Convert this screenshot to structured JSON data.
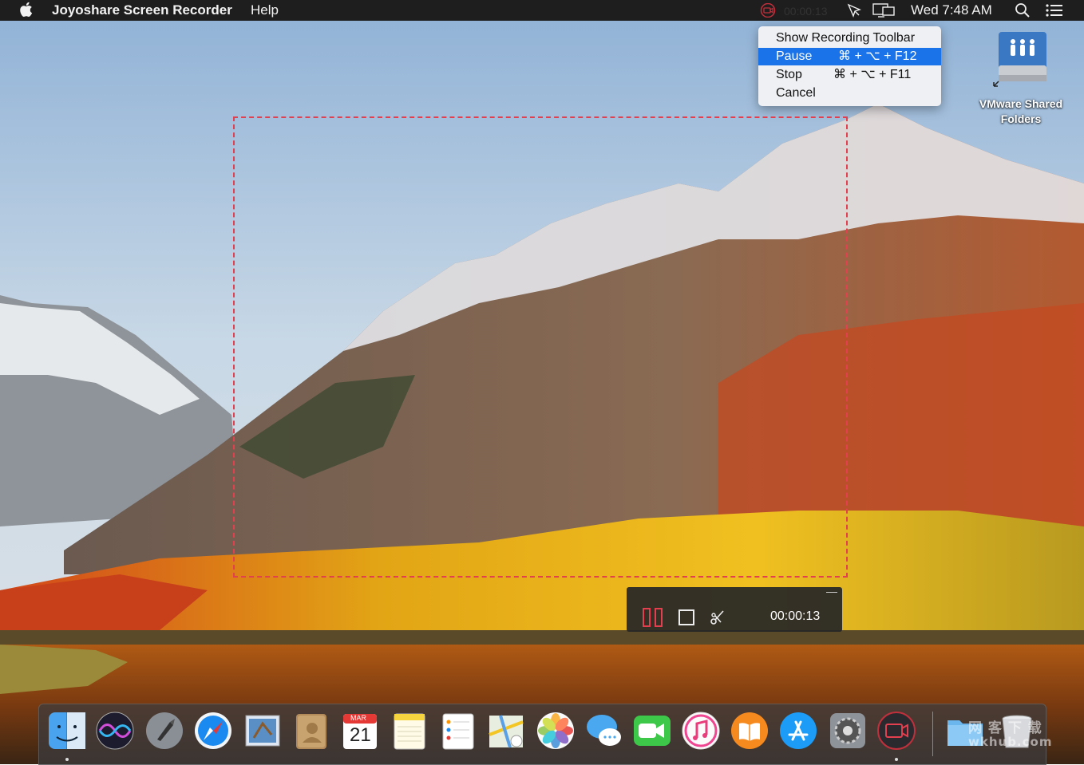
{
  "menubar": {
    "app_name": "Joyoshare Screen Recorder",
    "menus": [
      "Help"
    ],
    "recording_time": "00:00:13",
    "clock": "Wed 7:48 AM",
    "icons": [
      "apple-icon",
      "record-status-icon",
      "airplay-cursor-icon",
      "display-icon",
      "search-icon",
      "notification-list-icon"
    ]
  },
  "dropdown": {
    "items": [
      {
        "label": "Show Recording Toolbar",
        "shortcut": ""
      },
      {
        "label": "Pause",
        "shortcut": "⌘ + ⌥ + F12",
        "selected": true
      },
      {
        "label": "Stop",
        "shortcut": "⌘ + ⌥ + F11"
      },
      {
        "label": "Cancel",
        "shortcut": ""
      }
    ],
    "highlight_color": "#1a73e8"
  },
  "desktop": {
    "shared_folder_label_1": "VMware Shared",
    "shared_folder_label_2": "Folders"
  },
  "recording_area": {
    "border_color": "#e2404f"
  },
  "recording_toolbar": {
    "time": "00:00:13",
    "controls": [
      "pause",
      "stop",
      "cut"
    ]
  },
  "dock": {
    "calendar_month": "MAR",
    "calendar_day": "21",
    "apps": [
      "Finder",
      "Siri",
      "Launchpad",
      "Safari",
      "Mail",
      "Contacts",
      "Calendar",
      "Notes",
      "Reminders",
      "Maps",
      "Photos",
      "Messages",
      "FaceTime",
      "iTunes",
      "iBooks",
      "App Store",
      "System Preferences",
      "Joyoshare Screen Recorder",
      "Downloads",
      "Trash"
    ],
    "watermark_line1": "网 客 下 载",
    "watermark_line2": "wkhub.com"
  }
}
